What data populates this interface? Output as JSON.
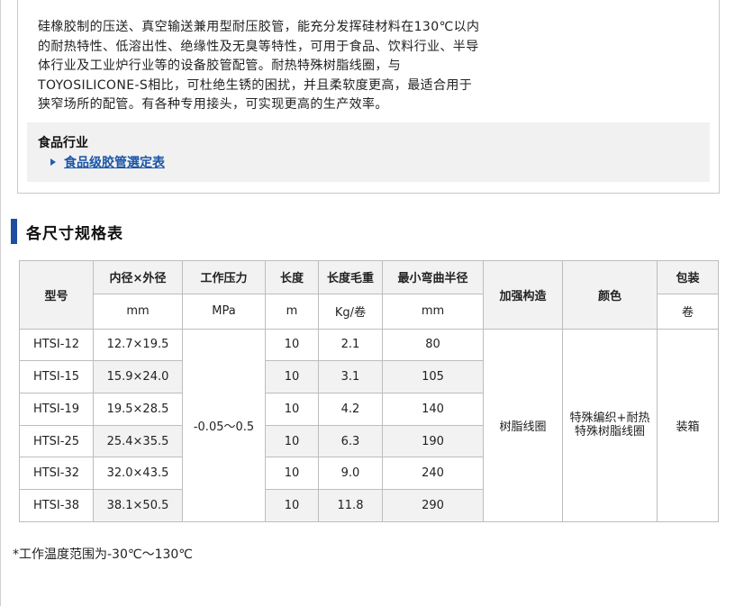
{
  "intro": {
    "lines": [
      "硅橡胶制的压送、真空输送兼用型耐压胶管，能充分发挥硅材料在130℃以内",
      "的耐热特性、低溶出性、绝缘性及无臭等特性，可用于食品、饮料行业、半导",
      "体行业及工业炉行业等的设备胶管配管。耐热特殊树脂线圈，与",
      "TOYOSILICONE-S相比，可杜绝生锈的困扰，并且柔软度更高，最适合用于",
      "狭窄场所的配管。有各种专用接头，可实现更高的生产效率。"
    ]
  },
  "industry": {
    "title": "食品行业",
    "link_label": "食品级胶管選定表"
  },
  "section": {
    "title": "各尺寸规格表"
  },
  "table": {
    "headers": {
      "model": "型号",
      "diameter": "内径×外径",
      "pressure": "工作压力",
      "length": "长度",
      "weight": "长度毛重",
      "bend": "最小弯曲半径",
      "reinforcement": "加强构造",
      "color": "颜色",
      "package": "包装"
    },
    "units": {
      "diameter": "mm",
      "pressure": "MPa",
      "length": "m",
      "weight": "Kg/卷",
      "bend": "mm",
      "package": "卷"
    },
    "rows": [
      {
        "model": "HTSI-12",
        "diameter": "12.7×19.5",
        "length": "10",
        "weight": "2.1",
        "bend": "80"
      },
      {
        "model": "HTSI-15",
        "diameter": "15.9×24.0",
        "length": "10",
        "weight": "3.1",
        "bend": "105"
      },
      {
        "model": "HTSI-19",
        "diameter": "19.5×28.5",
        "length": "10",
        "weight": "4.2",
        "bend": "140"
      },
      {
        "model": "HTSI-25",
        "diameter": "25.4×35.5",
        "length": "10",
        "weight": "6.3",
        "bend": "190"
      },
      {
        "model": "HTSI-32",
        "diameter": "32.0×43.5",
        "length": "10",
        "weight": "9.0",
        "bend": "240"
      },
      {
        "model": "HTSI-38",
        "diameter": "38.1×50.5",
        "length": "10",
        "weight": "11.8",
        "bend": "290"
      }
    ],
    "shared": {
      "pressure": "-0.05～0.5",
      "reinforcement": "树脂线圈",
      "color_line1": "特殊编织+耐热",
      "color_line2": "特殊树脂线圈",
      "package": "装箱"
    }
  },
  "footnote": "*工作温度范围为-30℃～130℃"
}
